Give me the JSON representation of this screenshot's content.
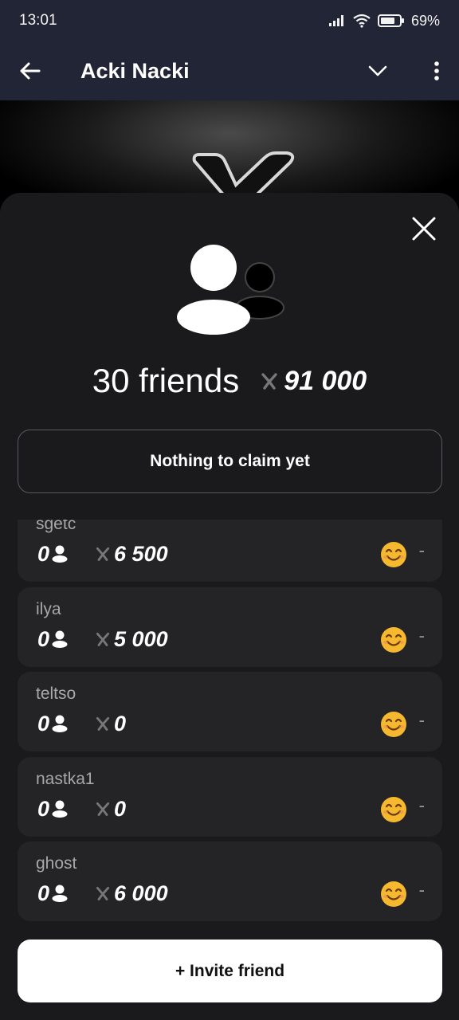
{
  "status": {
    "time": "13:01",
    "battery": "69%"
  },
  "app_bar": {
    "title": "Acki Nacki"
  },
  "summary": {
    "friends_label": "30 friends",
    "total_amount": "91 000"
  },
  "claim": {
    "label": "Nothing to claim yet"
  },
  "friends": [
    {
      "name": "sgetc",
      "count": "0",
      "amount": "6 500",
      "status": "-"
    },
    {
      "name": "ilya",
      "count": "0",
      "amount": "5 000",
      "status": "-"
    },
    {
      "name": "teltso",
      "count": "0",
      "amount": "0",
      "status": "-"
    },
    {
      "name": "nastka1",
      "count": "0",
      "amount": "0",
      "status": "-"
    },
    {
      "name": "ghost",
      "count": "0",
      "amount": "6 000",
      "status": "-"
    }
  ],
  "invite": {
    "label": "+ Invite friend"
  },
  "colors": {
    "app_bar_bg": "#222536",
    "sheet_bg": "#1a1a1d",
    "row_bg": "#242427",
    "emoji": "#f5b82e"
  },
  "icons": [
    "back-arrow-icon",
    "chevron-down-icon",
    "more-vert-icon",
    "close-icon",
    "friends-icon",
    "token-x-icon",
    "person-icon",
    "smile-emoji-icon",
    "wifi-icon",
    "signal-icon",
    "battery-icon"
  ]
}
